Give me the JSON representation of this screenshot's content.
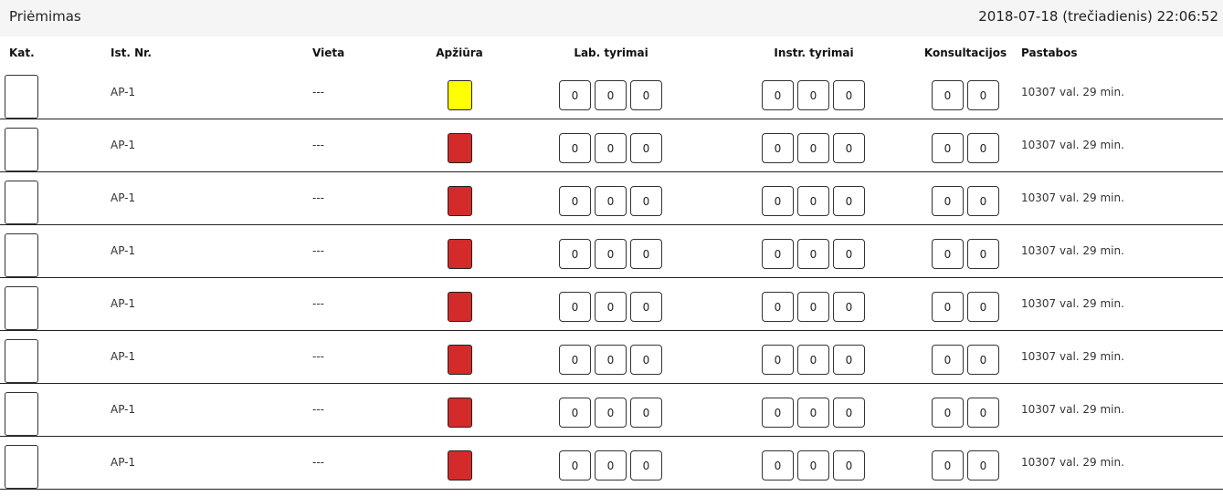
{
  "header": {
    "title": "Priėmimas",
    "datetime": "2018-07-18 (trečiadienis) 22:06:52"
  },
  "columns": {
    "kat": "Kat.",
    "ist_nr": "Ist. Nr.",
    "vieta": "Vieta",
    "apziura": "Apžiūra",
    "lab": "Lab. tyrimai",
    "instr": "Instr. tyrimai",
    "konsult": "Konsultacijos",
    "pastabos": "Pastabos"
  },
  "colors": {
    "yellow": "#ffff00",
    "red": "#d42a2a"
  },
  "rows": [
    {
      "ist_nr": "AP-1",
      "vieta": "---",
      "apziura": "yellow",
      "lab": [
        "0",
        "0",
        "0"
      ],
      "instr": [
        "0",
        "0",
        "0"
      ],
      "konsult": [
        "0",
        "0"
      ],
      "pastabos": "10307 val. 29 min."
    },
    {
      "ist_nr": "AP-1",
      "vieta": "---",
      "apziura": "red",
      "lab": [
        "0",
        "0",
        "0"
      ],
      "instr": [
        "0",
        "0",
        "0"
      ],
      "konsult": [
        "0",
        "0"
      ],
      "pastabos": "10307 val. 29 min."
    },
    {
      "ist_nr": "AP-1",
      "vieta": "---",
      "apziura": "red",
      "lab": [
        "0",
        "0",
        "0"
      ],
      "instr": [
        "0",
        "0",
        "0"
      ],
      "konsult": [
        "0",
        "0"
      ],
      "pastabos": "10307 val. 29 min."
    },
    {
      "ist_nr": "AP-1",
      "vieta": "---",
      "apziura": "red",
      "lab": [
        "0",
        "0",
        "0"
      ],
      "instr": [
        "0",
        "0",
        "0"
      ],
      "konsult": [
        "0",
        "0"
      ],
      "pastabos": "10307 val. 29 min."
    },
    {
      "ist_nr": "AP-1",
      "vieta": "---",
      "apziura": "red",
      "lab": [
        "0",
        "0",
        "0"
      ],
      "instr": [
        "0",
        "0",
        "0"
      ],
      "konsult": [
        "0",
        "0"
      ],
      "pastabos": "10307 val. 29 min."
    },
    {
      "ist_nr": "AP-1",
      "vieta": "---",
      "apziura": "red",
      "lab": [
        "0",
        "0",
        "0"
      ],
      "instr": [
        "0",
        "0",
        "0"
      ],
      "konsult": [
        "0",
        "0"
      ],
      "pastabos": "10307 val. 29 min."
    },
    {
      "ist_nr": "AP-1",
      "vieta": "---",
      "apziura": "red",
      "lab": [
        "0",
        "0",
        "0"
      ],
      "instr": [
        "0",
        "0",
        "0"
      ],
      "konsult": [
        "0",
        "0"
      ],
      "pastabos": "10307 val. 29 min."
    },
    {
      "ist_nr": "AP-1",
      "vieta": "---",
      "apziura": "red",
      "lab": [
        "0",
        "0",
        "0"
      ],
      "instr": [
        "0",
        "0",
        "0"
      ],
      "konsult": [
        "0",
        "0"
      ],
      "pastabos": "10307 val. 29 min."
    }
  ]
}
